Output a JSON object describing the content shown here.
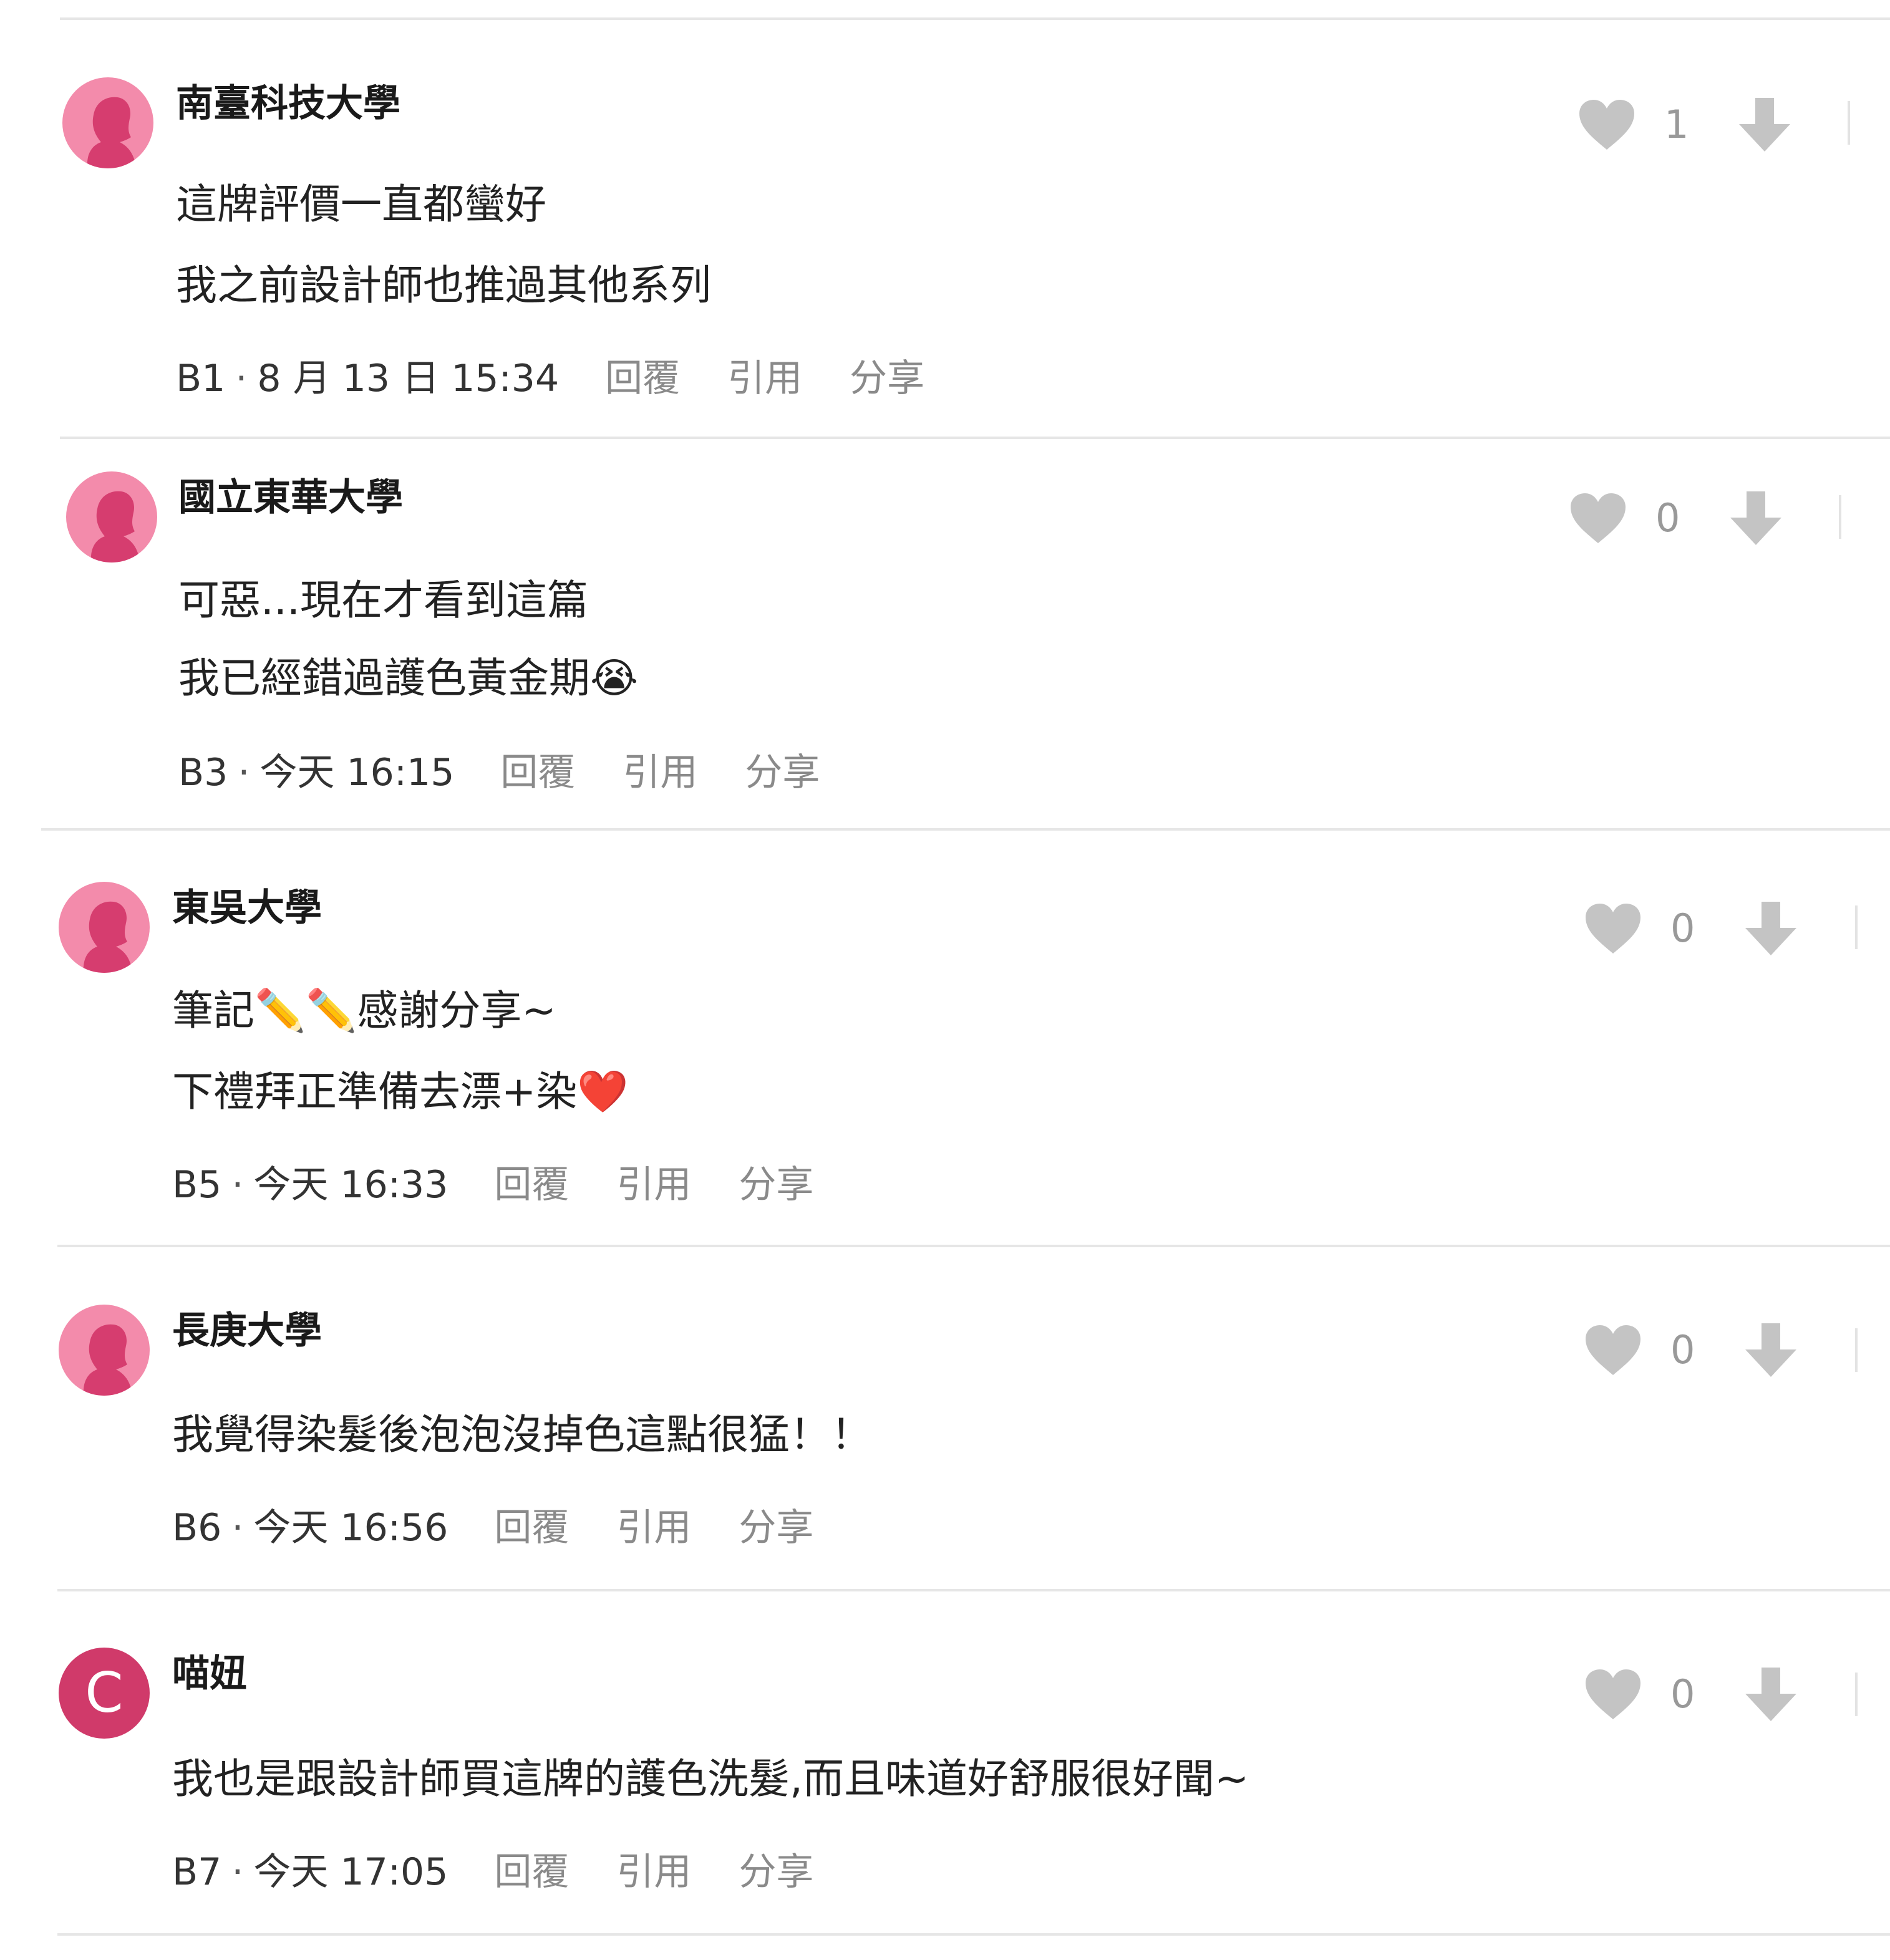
{
  "comments": [
    {
      "author": "南臺科技大學",
      "avatar": "silhouette",
      "lines": [
        "這牌評價一直都蠻好",
        "我之前設計師也推過其他系列"
      ],
      "floor": "B1",
      "time": "8 月 13 日 15:34",
      "likes": "1"
    },
    {
      "author": "國立東華大學",
      "avatar": "silhouette",
      "lines": [
        "可惡...現在才看到這篇",
        "我已經錯過護色黃金期😭"
      ],
      "floor": "B3",
      "time": "今天 16:15",
      "likes": "0"
    },
    {
      "author": "東吳大學",
      "avatar": "silhouette",
      "lines": [
        "筆記✏️✏️感謝分享~",
        "下禮拜正準備去漂+染❤️"
      ],
      "floor": "B5",
      "time": "今天 16:33",
      "likes": "0"
    },
    {
      "author": "長庚大學",
      "avatar": "silhouette",
      "lines": [
        "我覺得染髮後泡泡沒掉色這點很猛！！"
      ],
      "floor": "B6",
      "time": "今天 16:56",
      "likes": "0"
    },
    {
      "author": "喵妞",
      "avatar": "letter",
      "avatar_letter": "C",
      "lines": [
        "我也是跟設計師買這牌的護色洗髮,而且味道好舒服很好聞~"
      ],
      "floor": "B7",
      "time": "今天 17:05",
      "likes": "0"
    }
  ],
  "actions": {
    "reply": "回覆",
    "quote": "引用",
    "share": "分享"
  },
  "meta_separator": "·",
  "icons": {
    "like": "heart-icon",
    "dislike": "arrow-down-icon",
    "more": "more-options-icon"
  },
  "colors": {
    "avatar_pink": "#f38bab",
    "avatar_silhouette": "#d63d6f",
    "avatar_letter_bg": "#d03a6a",
    "icon_gray": "#c4c4c4",
    "action_gray": "#8a8a8a",
    "divider": "#e6e6e6"
  }
}
